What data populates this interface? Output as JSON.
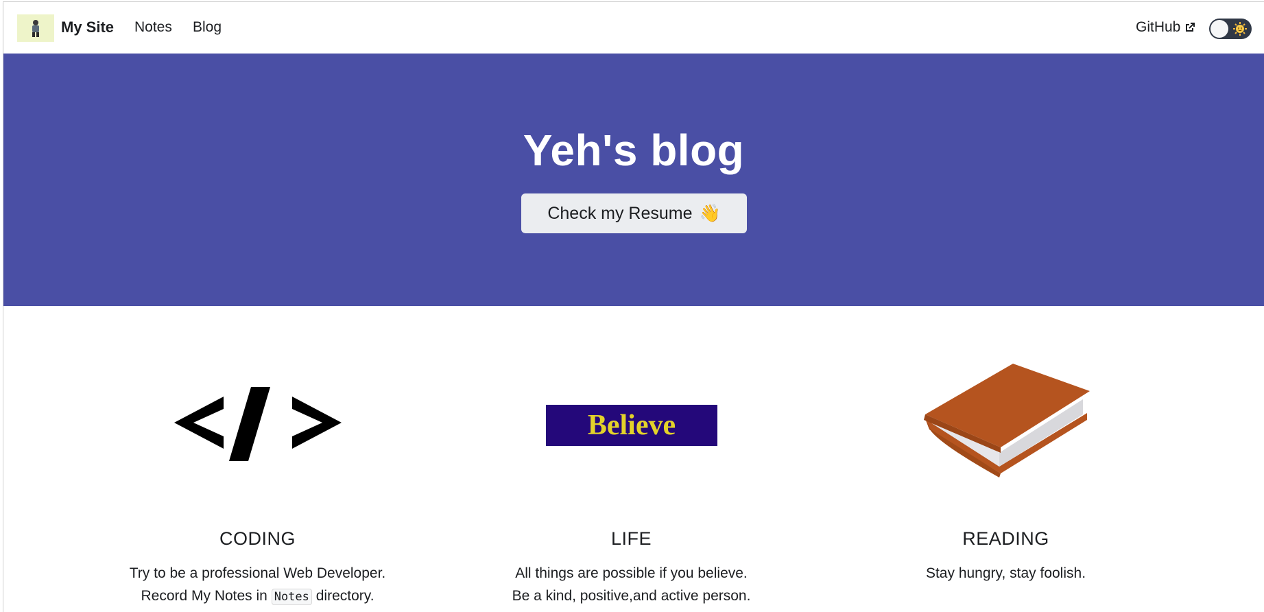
{
  "navbar": {
    "brand": "My Site",
    "logo_icon": "avatar-logo",
    "links": {
      "notes": "Notes",
      "blog": "Blog"
    },
    "github": "GitHub",
    "github_icon": "external-link-icon",
    "theme_toggle_icon": "sun-icon"
  },
  "hero": {
    "title": "Yeh's blog",
    "button_label": "Check my Resume",
    "button_emoji": "👋",
    "background": "#4a4fa5"
  },
  "features": {
    "coding": {
      "title": "CODING",
      "line1": "Try to be a professional Web Developer.",
      "line2_before": "Record My Notes in ",
      "line2_code": "Notes",
      "line2_after": " directory.",
      "image_icon": "code-brackets-icon"
    },
    "life": {
      "title": "LIFE",
      "line1": "All things are possible if you believe.",
      "line2": "Be a kind, positive,and active person.",
      "image_text": "Believe"
    },
    "reading": {
      "title": "READING",
      "line1": "Stay hungry, stay foolish.",
      "image_icon": "book-icon"
    }
  },
  "colors": {
    "hero_bg": "#4a4fa5",
    "believe_bg": "#24087a",
    "believe_text": "#e3d22a",
    "book_cover": "#b5541f"
  }
}
